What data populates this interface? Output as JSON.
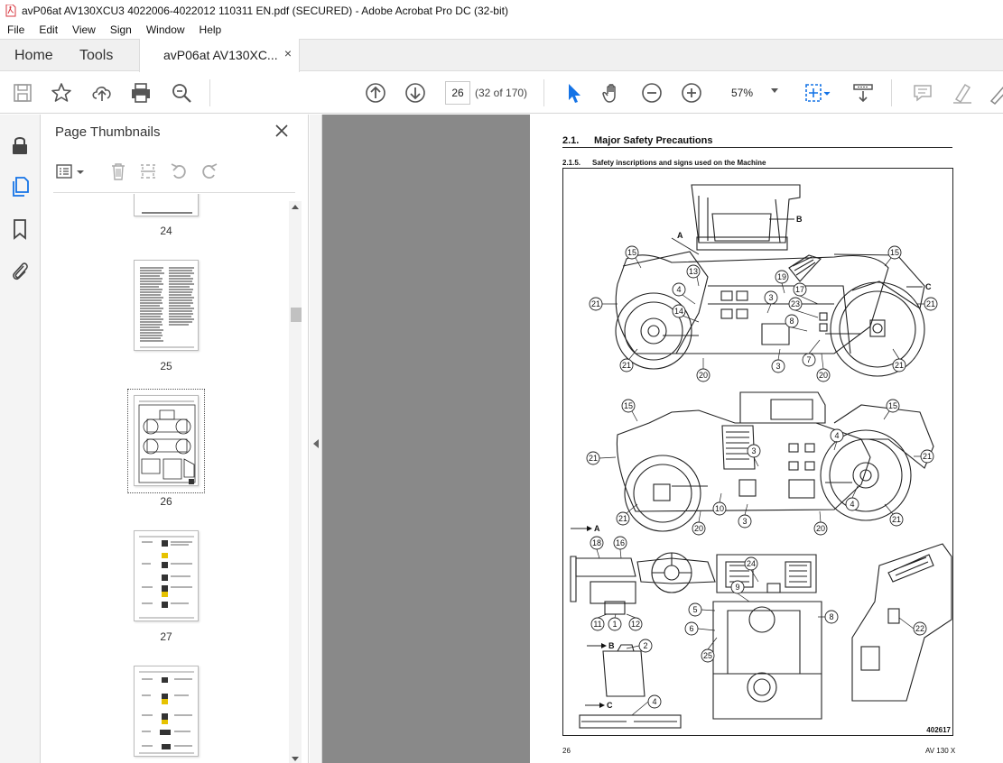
{
  "window": {
    "title": "avP06at AV130XCU3 4022006-4022012 110311 EN.pdf (SECURED) - Adobe Acrobat Pro DC (32-bit)"
  },
  "menu": [
    "File",
    "Edit",
    "View",
    "Sign",
    "Window",
    "Help"
  ],
  "tabs": {
    "home": "Home",
    "tools": "Tools",
    "document": "avP06at AV130XC...",
    "close": "×"
  },
  "toolbar": {
    "page_current": "26",
    "page_of": "(32 of 170)",
    "zoom": "57%",
    "icons": [
      "save-icon",
      "star-icon",
      "upload-icon",
      "print-icon",
      "zoom-search-icon",
      "prev-page-icon",
      "next-page-icon",
      "select-arrow-icon",
      "hand-icon",
      "zoom-out-icon",
      "zoom-in-icon",
      "fit-page-icon",
      "scroll-mode-icon",
      "comment-icon",
      "highlight-icon",
      "draw-icon"
    ]
  },
  "sidebar": {
    "title": "Page Thumbnails",
    "thumbnails": [
      {
        "label": "24"
      },
      {
        "label": "25"
      },
      {
        "label": "26"
      },
      {
        "label": "27"
      },
      {
        "label": ""
      }
    ]
  },
  "pdf": {
    "section_number": "2.1.",
    "section_title": "Major Safety Precautions",
    "subsection_number": "2.1.5.",
    "subsection_title": "Safety inscriptions and signs used on the Machine",
    "figure_id": "402617",
    "footer_page": "26",
    "footer_model": "AV 130 X",
    "callouts": {
      "view_a": "A",
      "view_b": "B",
      "view_c": "C"
    }
  },
  "colors": {
    "doc_background": "#898989",
    "accent_blue": "#1473e6",
    "acrobat_red": "#d7373f"
  }
}
